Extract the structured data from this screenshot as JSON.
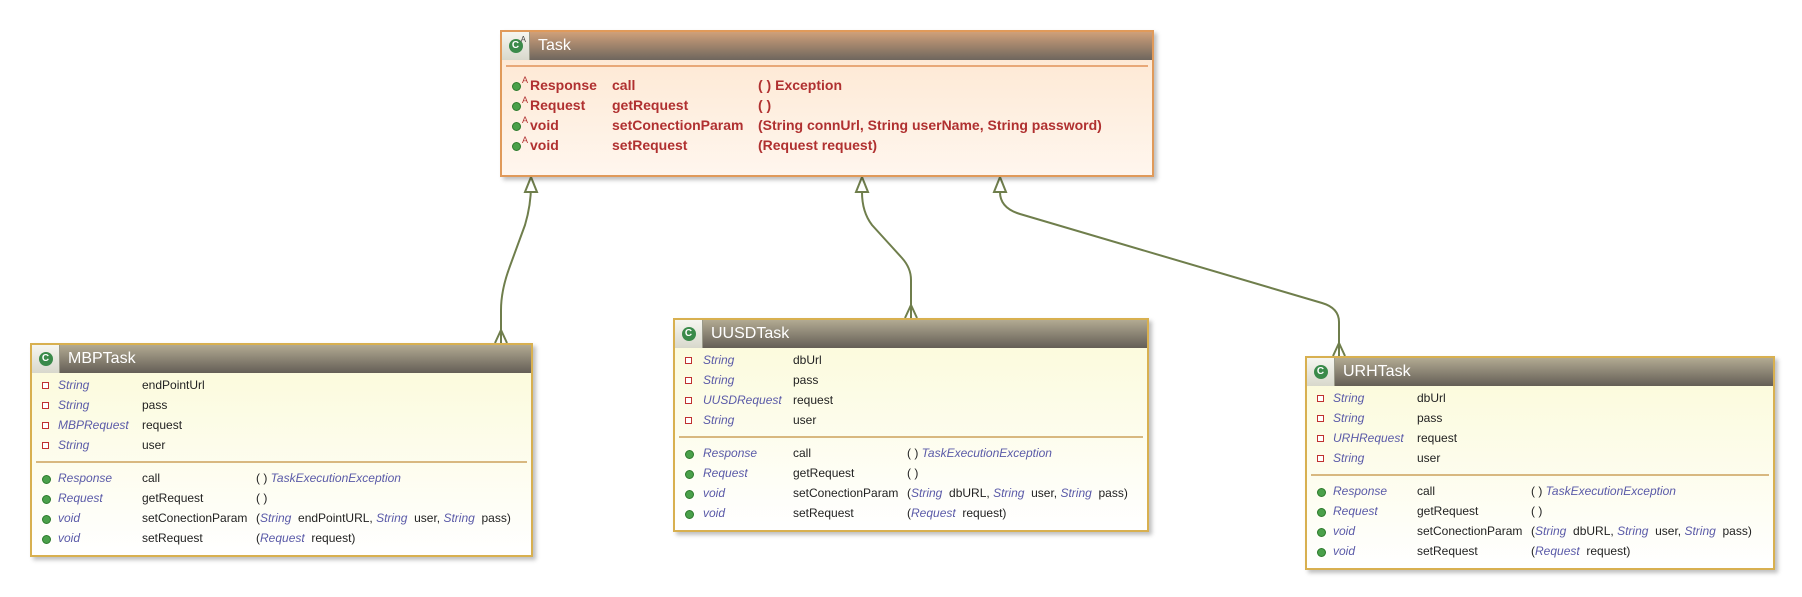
{
  "diagram": {
    "colors": {
      "edge": "#6f7e4c",
      "abstract_border": "#e09a5a",
      "concrete_border": "#d8b050",
      "member_type": "#5a5aa8",
      "abstract_text": "#b03030"
    },
    "relation": "realization",
    "task": {
      "name": "Task",
      "icon": "class-icon",
      "methods": [
        {
          "ret": "Response",
          "name": "call",
          "params": "( ) Exception"
        },
        {
          "ret": "Request",
          "name": "getRequest",
          "params": "( )"
        },
        {
          "ret": "void",
          "name": "setConectionParam",
          "params": "(String  connUrl, String  userName, String  password)"
        },
        {
          "ret": "void",
          "name": "setRequest",
          "params": "(Request  request)"
        }
      ]
    },
    "mbp": {
      "name": "MBPTask",
      "fields": [
        {
          "type": "String",
          "name": "endPointUrl"
        },
        {
          "type": "String",
          "name": "pass"
        },
        {
          "type": "MBPRequest",
          "name": "request"
        },
        {
          "type": "String",
          "name": "user"
        }
      ],
      "methods": [
        {
          "ret": "Response",
          "name": "call",
          "p_open": "( ) ",
          "p_type1": "TaskExecutionException"
        },
        {
          "ret": "Request",
          "name": "getRequest",
          "p_open": "( )"
        },
        {
          "ret": "void",
          "name": "setConectionParam",
          "p_open": "(",
          "p_type1": "String",
          "p_name1": "  endPointURL, ",
          "p_type2": "String",
          "p_name2": "  user, ",
          "p_type3": "String",
          "p_name3": "  pass)"
        },
        {
          "ret": "void",
          "name": "setRequest",
          "p_open": "(",
          "p_type1": "Request",
          "p_name1": "  request)"
        }
      ]
    },
    "uusd": {
      "name": "UUSDTask",
      "fields": [
        {
          "type": "String",
          "name": "dbUrl"
        },
        {
          "type": "String",
          "name": "pass"
        },
        {
          "type": "UUSDRequest",
          "name": "request"
        },
        {
          "type": "String",
          "name": "user"
        }
      ],
      "methods": [
        {
          "ret": "Response",
          "name": "call",
          "p_open": "( ) ",
          "p_type1": "TaskExecutionException"
        },
        {
          "ret": "Request",
          "name": "getRequest",
          "p_open": "( )"
        },
        {
          "ret": "void",
          "name": "setConectionParam",
          "p_open": "(",
          "p_type1": "String",
          "p_name1": "  dbURL, ",
          "p_type2": "String",
          "p_name2": "  user, ",
          "p_type3": "String",
          "p_name3": "  pass)"
        },
        {
          "ret": "void",
          "name": "setRequest",
          "p_open": "(",
          "p_type1": "Request",
          "p_name1": "  request)"
        }
      ]
    },
    "urh": {
      "name": "URHTask",
      "fields": [
        {
          "type": "String",
          "name": "dbUrl"
        },
        {
          "type": "String",
          "name": "pass"
        },
        {
          "type": "URHRequest",
          "name": "request"
        },
        {
          "type": "String",
          "name": "user"
        }
      ],
      "methods": [
        {
          "ret": "Response",
          "name": "call",
          "p_open": "( ) ",
          "p_type1": "TaskExecutionException"
        },
        {
          "ret": "Request",
          "name": "getRequest",
          "p_open": "( )"
        },
        {
          "ret": "void",
          "name": "setConectionParam",
          "p_open": "(",
          "p_type1": "String",
          "p_name1": "  dbURL, ",
          "p_type2": "String",
          "p_name2": "  user, ",
          "p_type3": "String",
          "p_name3": "  pass)"
        },
        {
          "ret": "void",
          "name": "setRequest",
          "p_open": "(",
          "p_type1": "Request",
          "p_name1": "  request)"
        }
      ]
    }
  }
}
